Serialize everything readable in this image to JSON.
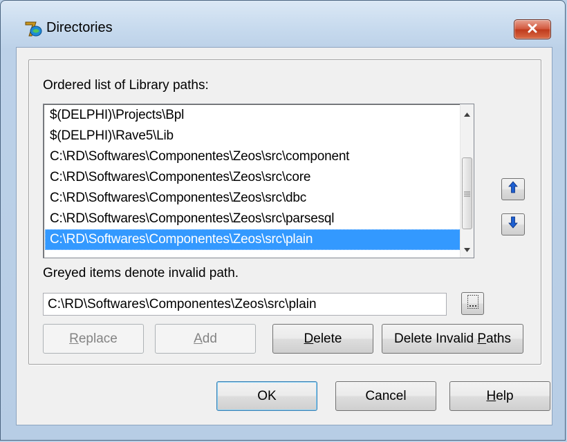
{
  "window": {
    "title": "Directories"
  },
  "library": {
    "list_label": "Ordered list of Library paths:",
    "items": [
      "$(DELPHI)\\Projects\\Bpl",
      "$(DELPHI)\\Rave5\\Lib",
      "C:\\RD\\Softwares\\Componentes\\Zeos\\src\\component",
      "C:\\RD\\Softwares\\Componentes\\Zeos\\src\\core",
      "C:\\RD\\Softwares\\Componentes\\Zeos\\src\\dbc",
      "C:\\RD\\Softwares\\Componentes\\Zeos\\src\\parsesql",
      "C:\\RD\\Softwares\\Componentes\\Zeos\\src\\plain"
    ],
    "selected_index": 6,
    "hint": "Greyed items denote invalid path.",
    "path_value": "C:\\RD\\Softwares\\Componentes\\Zeos\\src\\plain"
  },
  "buttons": {
    "replace": {
      "accel": "R",
      "rest": "eplace"
    },
    "add": {
      "accel": "A",
      "rest": "dd"
    },
    "delete": {
      "accel": "D",
      "rest": "elete"
    },
    "delete_invalid": {
      "pre": "Delete Invalid ",
      "accel": "P",
      "rest": "aths"
    },
    "ok": "OK",
    "cancel": "Cancel",
    "help": {
      "accel": "H",
      "rest": "elp"
    }
  },
  "icons": {
    "app": "delphi-icon",
    "close": "close-icon",
    "move_up": "arrow-up-icon",
    "move_down": "arrow-down-icon",
    "browse": "folder-browse-icon"
  },
  "colors": {
    "selection": "#3399ff",
    "arrow_blue": "#1d5fd0",
    "close_red": "#c7452a"
  }
}
